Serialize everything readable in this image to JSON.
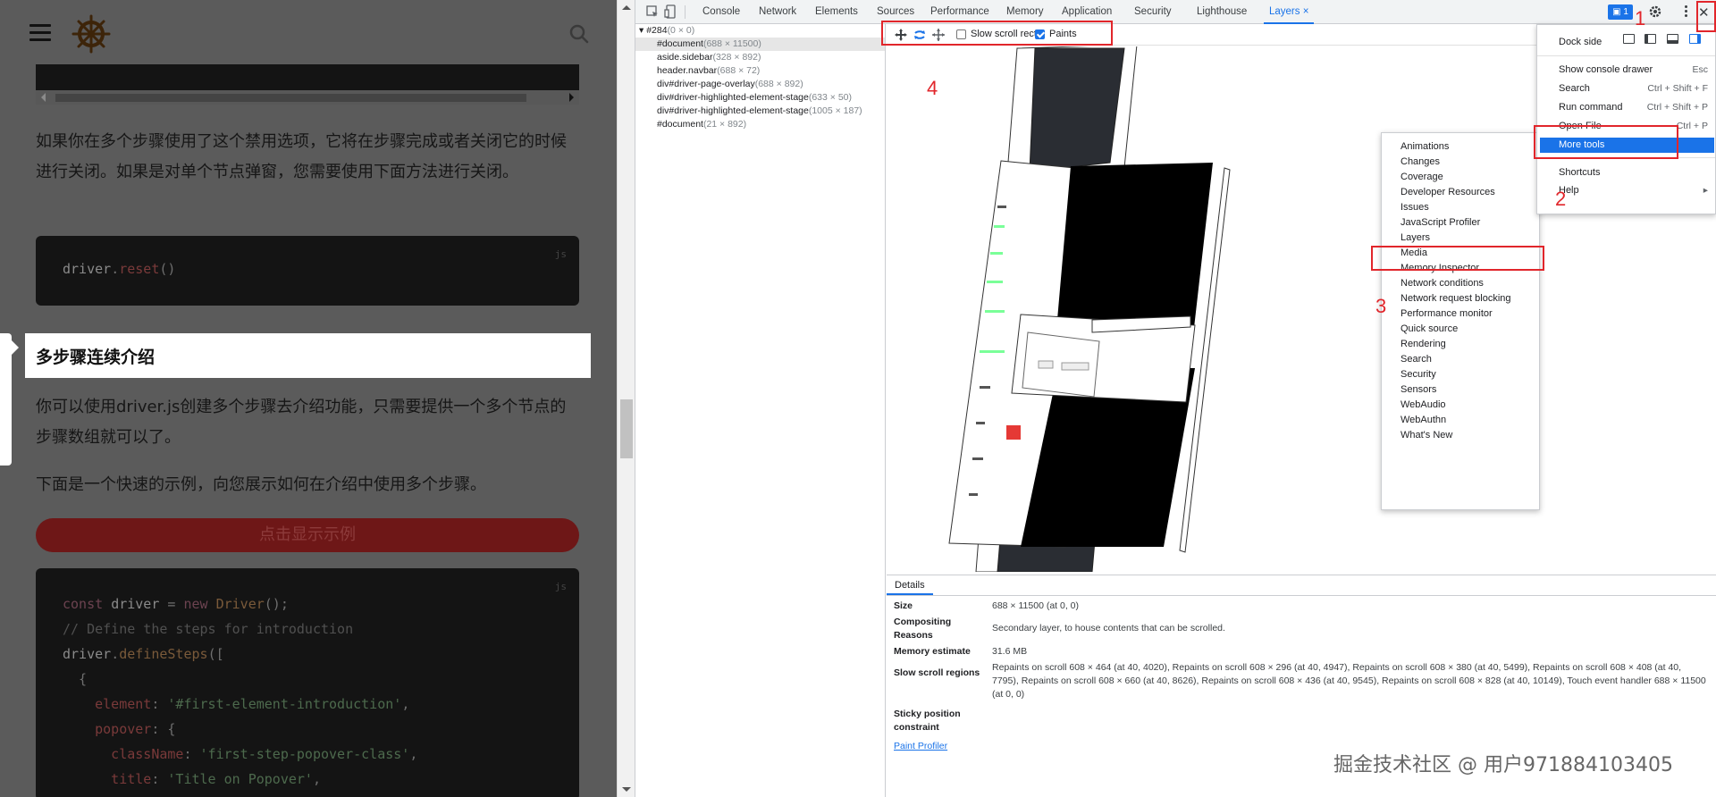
{
  "page": {
    "para1": "如果你在多个步骤使用了这个禁用选项，它将在步骤完成或者关闭它的时候进行关闭。如果是对单个节点弹窗，您需要使用下面方法进行关闭。",
    "code1_lang": "js",
    "code1_obj": "driver",
    "code1_method": "reset",
    "code1_tail": "()",
    "section_title": "多步骤连续介绍",
    "para2": "你可以使用driver.js创建多个步骤去介绍功能，只需要提供一个多个节点的步骤数组就可以了。",
    "para3": "下面是一个快速的示例，向您展示如何在介绍中使用多个步骤。",
    "show_example_button": "点击显示示例",
    "code2_lang": "js",
    "code2": {
      "l1a": "const ",
      "l1b": "driver",
      "l1c": " = ",
      "l1d": "new ",
      "l1e": "Driver",
      "l1f": "();",
      "l2": "// Define the steps for introduction",
      "l3a": "driver",
      "l3b": ".",
      "l3c": "defineSteps",
      "l3d": "([",
      "l4": "  {",
      "l5a": "    element",
      "l5b": ": ",
      "l5c": "'#first-element-introduction'",
      "l5d": ",",
      "l6a": "    popover",
      "l6b": ": {",
      "l7a": "      className",
      "l7b": ": ",
      "l7c": "'first-step-popover-class'",
      "l7d": ",",
      "l8a": "      title",
      "l8b": ": ",
      "l8c": "'Title on Popover'",
      "l8d": ","
    }
  },
  "devtools": {
    "tabs": [
      "Console",
      "Network",
      "Elements",
      "Sources",
      "Performance",
      "Memory",
      "Application",
      "Security",
      "Lighthouse",
      "Layers"
    ],
    "active_tab": "Layers",
    "issues_count": "1",
    "close_tab_glyph": "×",
    "close_glyph": "✕",
    "layer_tree": [
      {
        "name": "#284",
        "dim": "(0 × 0)"
      },
      {
        "name": "#document",
        "dim": "(688 × 11500)"
      },
      {
        "name": "aside.sidebar",
        "dim": "(328 × 892)"
      },
      {
        "name": "header.navbar",
        "dim": "(688 × 72)"
      },
      {
        "name": "div#driver-page-overlay",
        "dim": "(688 × 892)"
      },
      {
        "name": "div#driver-highlighted-element-stage",
        "dim": "(633 × 50)"
      },
      {
        "name": "div#driver-highlighted-element-stage",
        "dim": "(1005 × 187)"
      },
      {
        "name": "#document",
        "dim": "(21 × 892)"
      }
    ],
    "toolbar": {
      "slow_scroll_label": "Slow scroll rects",
      "slow_scroll_checked": false,
      "paints_label": "Paints",
      "paints_checked": true
    },
    "details": {
      "tab": "Details",
      "size_label": "Size",
      "size_value": "688 × 11500 (at 0, 0)",
      "compositing_label": "Compositing Reasons",
      "compositing_value": "Secondary layer, to house contents that can be scrolled.",
      "memory_label": "Memory estimate",
      "memory_value": "31.6 MB",
      "slow_label": "Slow scroll regions",
      "slow_value": "Repaints on scroll 608 × 464 (at 40, 4020), Repaints on scroll 608 × 296 (at 40, 4947), Repaints on scroll 608 × 380 (at 40, 5499), Repaints on scroll 608 × 408 (at 40, 7795), Repaints on scroll 608 × 660 (at 40, 8626), Repaints on scroll 608 × 436 (at 40, 9545), Repaints on scroll 608 × 828 (at 40, 10149), Touch event handler 688 × 11500 (at 0, 0)",
      "sticky_label": "Sticky position constraint",
      "sticky_value": "",
      "paint_profiler": "Paint Profiler"
    },
    "main_menu": {
      "dock_side": "Dock side",
      "items": [
        {
          "label": "Show console drawer",
          "shortcut": "Esc"
        },
        {
          "label": "Search",
          "shortcut": "Ctrl + Shift + F"
        },
        {
          "label": "Run command",
          "shortcut": "Ctrl + Shift + P"
        },
        {
          "label": "Open File",
          "shortcut": "Ctrl + P"
        },
        {
          "label": "More tools",
          "shortcut": ""
        },
        {
          "label": "Shortcuts",
          "shortcut": ""
        },
        {
          "label": "Help",
          "shortcut": "▸"
        }
      ]
    },
    "more_tools": [
      "Animations",
      "Changes",
      "Coverage",
      "Developer Resources",
      "Issues",
      "JavaScript Profiler",
      "Layers",
      "Media",
      "Memory Inspector",
      "Network conditions",
      "Network request blocking",
      "Performance monitor",
      "Quick source",
      "Rendering",
      "Search",
      "Security",
      "Sensors",
      "WebAudio",
      "WebAuthn",
      "What's New"
    ]
  },
  "annotations": {
    "n1": "1",
    "n2": "2",
    "n3": "3",
    "n4": "4",
    "color": "#e1262b"
  },
  "watermark": "掘金技术社区 @ 用户971884103405",
  "colors": {
    "accent": "#1a73e8",
    "overlay": "#5b5b5b",
    "annotation": "#e1262b"
  }
}
